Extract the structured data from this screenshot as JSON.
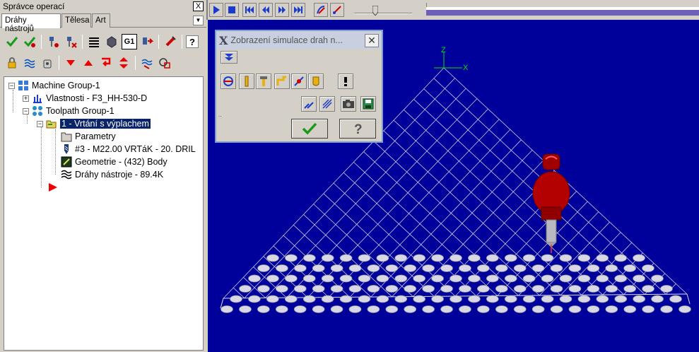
{
  "ops_manager": {
    "title": "Správce operací",
    "close_label": "X",
    "tabs": [
      "Dráhy nástrojů",
      "Tělesa",
      "Art"
    ]
  },
  "tree": {
    "machine_group": "Machine Group-1",
    "properties": "Vlastnosti - F3_HH-530-D",
    "toolpath_group": "Toolpath Group-1",
    "operation": "1 - Vrtání s výplachem",
    "parameters": "Parametry",
    "tool": "#3 - M22.00 VRTáK -   20. DRIL",
    "geometry": "Geometrie - (432) Body",
    "toolpaths": "Dráhy nástroje - 89.4K"
  },
  "dialog": {
    "title": "Zobrazení simulace drah n...",
    "close_label": "✕"
  },
  "axes": {
    "z": "Z",
    "x": "X"
  },
  "colors": {
    "viewport": "#00009a",
    "progress": "#6b5fb8",
    "selection": "#0a246a"
  }
}
